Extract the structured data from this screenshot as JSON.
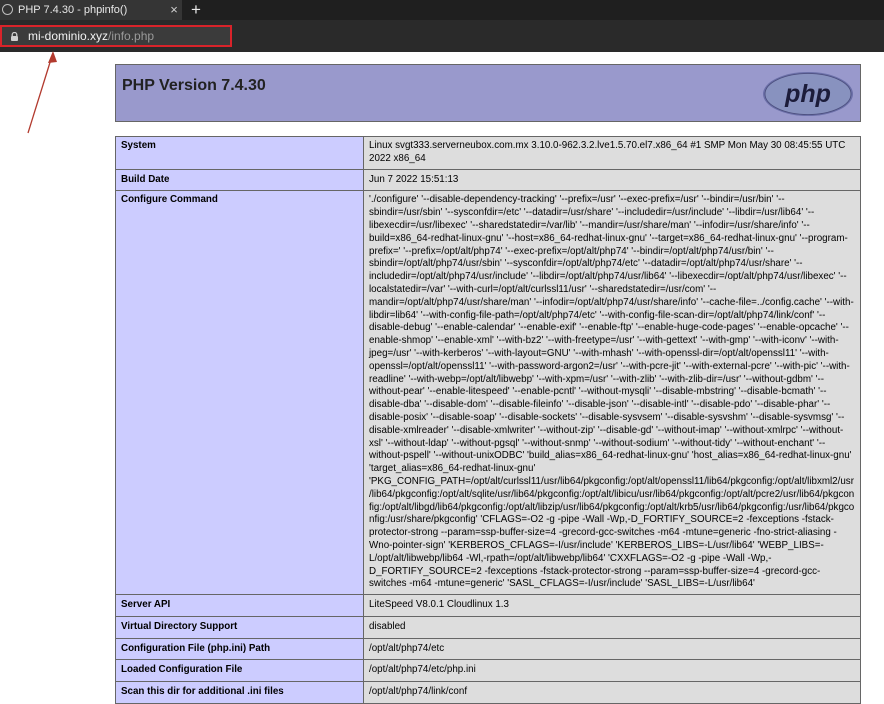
{
  "browser": {
    "tab_title": "PHP 7.4.30 - phpinfo()",
    "tab_close_glyph": "×",
    "new_tab_glyph": "+",
    "url_host": "mi-dominio.xyz",
    "url_path": "/info.php"
  },
  "colors": {
    "header_bg": "#9999cc",
    "label_bg": "#ccccff",
    "value_bg": "#dddddd",
    "highlight_box": "#d9232a"
  },
  "php": {
    "version_title": "PHP Version 7.4.30",
    "logo_text": "php",
    "rows": [
      {
        "key": "System",
        "value": "Linux svgt333.serverneubox.com.mx 3.10.0-962.3.2.lve1.5.70.el7.x86_64 #1 SMP Mon May 30 08:45:55 UTC 2022 x86_64"
      },
      {
        "key": "Build Date",
        "value": "Jun 7 2022 15:51:13"
      },
      {
        "key": "Configure Command",
        "value": "'./configure' '--disable-dependency-tracking' '--prefix=/usr' '--exec-prefix=/usr' '--bindir=/usr/bin' '--sbindir=/usr/sbin' '--sysconfdir=/etc' '--datadir=/usr/share' '--includedir=/usr/include' '--libdir=/usr/lib64' '--libexecdir=/usr/libexec' '--sharedstatedir=/var/lib' '--mandir=/usr/share/man' '--infodir=/usr/share/info' '--build=x86_64-redhat-linux-gnu' '--host=x86_64-redhat-linux-gnu' '--target=x86_64-redhat-linux-gnu' '--program-prefix=' '--prefix=/opt/alt/php74' '--exec-prefix=/opt/alt/php74' '--bindir=/opt/alt/php74/usr/bin' '--sbindir=/opt/alt/php74/usr/sbin' '--sysconfdir=/opt/alt/php74/etc' '--datadir=/opt/alt/php74/usr/share' '--includedir=/opt/alt/php74/usr/include' '--libdir=/opt/alt/php74/usr/lib64' '--libexecdir=/opt/alt/php74/usr/libexec' '--localstatedir=/var' '--with-curl=/opt/alt/curlssl11/usr' '--sharedstatedir=/usr/com' '--mandir=/opt/alt/php74/usr/share/man' '--infodir=/opt/alt/php74/usr/share/info' '--cache-file=../config.cache' '--with-libdir=lib64' '--with-config-file-path=/opt/alt/php74/etc' '--with-config-file-scan-dir=/opt/alt/php74/link/conf' '--disable-debug' '--enable-calendar' '--enable-exif' '--enable-ftp' '--enable-huge-code-pages' '--enable-opcache' '--enable-shmop' '--enable-xml' '--with-bz2' '--with-freetype=/usr' '--with-gettext' '--with-gmp' '--with-iconv' '--with-jpeg=/usr' '--with-kerberos' '--with-layout=GNU' '--with-mhash' '--with-openssl-dir=/opt/alt/openssl11' '--with-openssl=/opt/alt/openssl11' '--with-password-argon2=/usr' '--with-pcre-jit' '--with-external-pcre' '--with-pic' '--with-readline' '--with-webp=/opt/alt/libwebp' '--with-xpm=/usr' '--with-zlib' '--with-zlib-dir=/usr' '--without-gdbm' '--without-pear' '--enable-litespeed' '--enable-pcntl' '--without-mysqli' '--disable-mbstring' '--disable-bcmath' '--disable-dba' '--disable-dom' '--disable-fileinfo' '--disable-json' '--disable-intl' '--disable-pdo' '--disable-phar' '--disable-posix' '--disable-soap' '--disable-sockets' '--disable-sysvsem' '--disable-sysvshm' '--disable-sysvmsg' '--disable-xmlreader' '--disable-xmlwriter' '--without-zip' '--disable-gd' '--without-imap' '--without-xmlrpc' '--without-xsl' '--without-ldap' '--without-pgsql' '--without-snmp' '--without-sodium' '--without-tidy' '--without-enchant' '--without-pspell' '--without-unixODBC' 'build_alias=x86_64-redhat-linux-gnu' 'host_alias=x86_64-redhat-linux-gnu' 'target_alias=x86_64-redhat-linux-gnu' 'PKG_CONFIG_PATH=/opt/alt/curlssl11/usr/lib64/pkgconfig:/opt/alt/openssl11/lib64/pkgconfig:/opt/alt/libxml2/usr/lib64/pkgconfig:/opt/alt/sqlite/usr/lib64/pkgconfig:/opt/alt/libicu/usr/lib64/pkgconfig:/opt/alt/pcre2/usr/lib64/pkgconfig:/opt/alt/libgd/lib64/pkgconfig:/opt/alt/libzip/usr/lib64/pkgconfig:/opt/alt/krb5/usr/lib64/pkgconfig:/usr/lib64/pkgconfig:/usr/share/pkgconfig' 'CFLAGS=-O2 -g -pipe -Wall -Wp,-D_FORTIFY_SOURCE=2 -fexceptions -fstack-protector-strong --param=ssp-buffer-size=4 -grecord-gcc-switches -m64 -mtune=generic -fno-strict-aliasing -Wno-pointer-sign' 'KERBEROS_CFLAGS=-I/usr/include' 'KERBEROS_LIBS=-L/usr/lib64' 'WEBP_LIBS=-L/opt/alt/libwebp/lib64 -Wl,-rpath=/opt/alt/libwebp/lib64' 'CXXFLAGS=-O2 -g -pipe -Wall -Wp,-D_FORTIFY_SOURCE=2 -fexceptions -fstack-protector-strong --param=ssp-buffer-size=4 -grecord-gcc-switches -m64 -mtune=generic' 'SASL_CFLAGS=-I/usr/include' 'SASL_LIBS=-L/usr/lib64'"
      },
      {
        "key": "Server API",
        "value": "LiteSpeed V8.0.1 Cloudlinux 1.3"
      },
      {
        "key": "Virtual Directory Support",
        "value": "disabled"
      },
      {
        "key": "Configuration File (php.ini) Path",
        "value": "/opt/alt/php74/etc"
      },
      {
        "key": "Loaded Configuration File",
        "value": "/opt/alt/php74/etc/php.ini"
      },
      {
        "key": "Scan this dir for additional .ini files",
        "value": "/opt/alt/php74/link/conf"
      }
    ]
  }
}
